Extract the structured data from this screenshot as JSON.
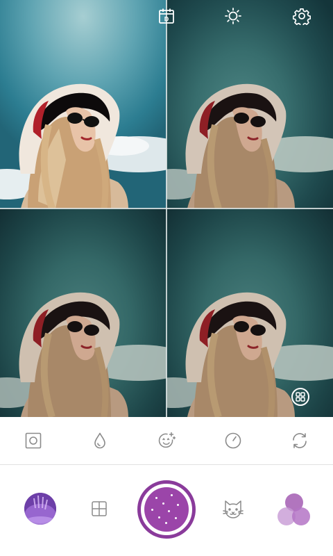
{
  "app": {
    "name": "camera-filter-preview"
  },
  "preview": {
    "cells": [
      {
        "filter": "original",
        "sky": "#5fa4b2"
      },
      {
        "filter": "vintage-teal-1",
        "sky": "#376d6d"
      },
      {
        "filter": "vintage-teal-2",
        "sky": "#346867"
      },
      {
        "filter": "vintage-teal-3",
        "sky": "#346867"
      }
    ]
  },
  "top_bar": {
    "icons": [
      "calendar-icon",
      "brightness-icon",
      "settings-icon"
    ],
    "calendar_letter": "D"
  },
  "toolbar": {
    "items": [
      "frame-icon",
      "drop-icon",
      "face-beauty-icon",
      "timer-icon",
      "switch-camera-icon"
    ]
  },
  "bottom_bar": {
    "items": [
      "gallery-thumbnail",
      "grid-layout-icon",
      "shutter-button",
      "sticker-cat-icon",
      "filter-circles-icon"
    ]
  },
  "colors": {
    "accent": "#8a3b9b",
    "shutter_fill": "#9b45a9",
    "icon_gray": "#8a8a8a",
    "icon_white": "#ffffff",
    "filter_circles": "#a35db3"
  }
}
